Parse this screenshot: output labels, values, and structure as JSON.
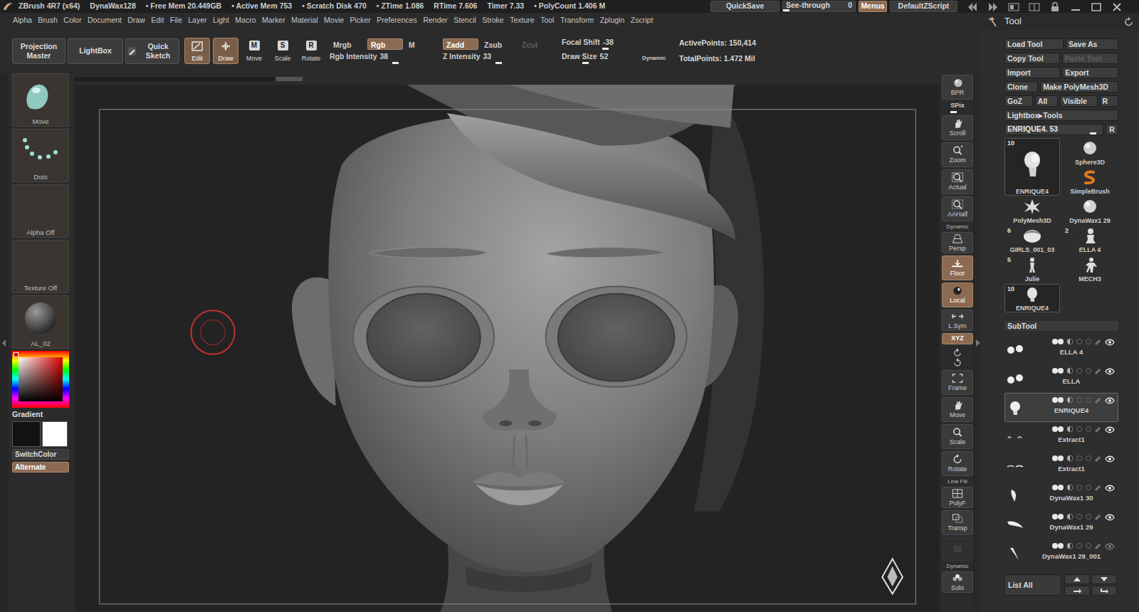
{
  "title_bar": {
    "items": [
      "ZBrush 4R7 (x64)",
      "DynaWax128",
      "• Free Mem 20.449GB",
      "• Active Mem 753",
      "• Scratch Disk 470",
      "• ZTime 1.086",
      "RTime 7.606",
      "Timer 7.33",
      "• PolyCount 1.406 M"
    ],
    "quicksave": "QuickSave",
    "see_through": {
      "label": "See-through",
      "value": "0",
      "level": 0
    },
    "menus": {
      "label": "Menus",
      "on": true
    },
    "script": "DefaultZScript"
  },
  "menu_bar": [
    "Alpha",
    "Brush",
    "Color",
    "Document",
    "Draw",
    "Edit",
    "File",
    "Layer",
    "Light",
    "Macro",
    "Marker",
    "Material",
    "Movie",
    "Picker",
    "Preferences",
    "Render",
    "Stencil",
    "Stroke",
    "Texture",
    "Tool",
    "Transform",
    "Zplugin",
    "Zscript"
  ],
  "shelf": {
    "buttons": [
      "Projection Master",
      "LightBox",
      "Quick Sketch"
    ],
    "modes": [
      {
        "label": "Edit",
        "selected": true
      },
      {
        "label": "Draw",
        "selected": true
      },
      {
        "label": "Move",
        "glyph": "M",
        "selected": false
      },
      {
        "label": "Scale",
        "glyph": "S",
        "selected": false
      },
      {
        "label": "Rotate",
        "glyph": "R",
        "selected": false
      }
    ],
    "toggles": [
      {
        "label": "Mrgb",
        "on": false,
        "disabled": false
      },
      {
        "label": "Rgb",
        "on": true,
        "disabled": false
      },
      {
        "label": "M",
        "on": false,
        "disabled": false
      },
      {
        "label": "Zadd",
        "on": true,
        "disabled": false
      },
      {
        "label": "Zsub",
        "on": false,
        "disabled": false
      },
      {
        "label": "Zcut",
        "on": false,
        "disabled": true
      }
    ],
    "intensity_sliders": [
      {
        "label": "Rgb Intensity",
        "value": "38",
        "level": 0.6
      },
      {
        "label": "Z Intensity",
        "value": "33",
        "level": 0.5
      }
    ],
    "brush_sliders": [
      {
        "label": "Focal Shift",
        "value": "-38",
        "level": 0.4
      },
      {
        "label": "Draw Size",
        "value": "52",
        "level": 0.3
      }
    ],
    "dynamic": {
      "label": "Dynamic",
      "on": false
    },
    "stats": [
      "ActivePoints: 150,414",
      "TotalPoints: 1.472 Mil"
    ]
  },
  "left_shelf": {
    "brush": "Move",
    "stroke": "Dots",
    "alpha": "Alpha Off",
    "texture": "Texture Off",
    "material": "AL_02",
    "picker": {
      "color": "#e00000"
    },
    "gradient": "Gradient",
    "swatches": [
      {
        "color": "#121212"
      },
      {
        "color": "#ffffff"
      }
    ],
    "switch_color": "SwitchColor",
    "alternate": {
      "label": "Alternate",
      "on": true
    }
  },
  "right_toolbar": [
    {
      "kind": "button",
      "label": "BPR",
      "on": false,
      "disabled": false
    },
    {
      "kind": "slider",
      "label": "SPix",
      "level": 0.35,
      "on": false,
      "disabled": false
    },
    {
      "kind": "button",
      "label": "Scroll",
      "on": false,
      "disabled": false
    },
    {
      "kind": "button",
      "label": "Zoom",
      "on": false,
      "disabled": false
    },
    {
      "kind": "button",
      "label": "Actual",
      "on": false,
      "disabled": false
    },
    {
      "kind": "button",
      "label": "AAHalf",
      "on": false,
      "disabled": false
    },
    {
      "kind": "short",
      "label": "Persp",
      "sub": "Dynamic",
      "on": false,
      "disabled": false
    },
    {
      "kind": "button",
      "label": "Floor",
      "on": true,
      "disabled": false
    },
    {
      "kind": "button",
      "label": "Local",
      "on": true,
      "disabled": false
    },
    {
      "kind": "short",
      "label": "L.Sym",
      "on": false,
      "disabled": false
    },
    {
      "kind": "tiny",
      "label": "XYZ",
      "on": true,
      "disabled": false
    },
    {
      "kind": "icons",
      "on": false,
      "disabled": false
    },
    {
      "kind": "button",
      "label": "Frame",
      "on": false,
      "disabled": false
    },
    {
      "kind": "button",
      "label": "Move",
      "on": false,
      "disabled": false
    },
    {
      "kind": "button",
      "label": "Scale",
      "on": false,
      "disabled": false
    },
    {
      "kind": "button",
      "label": "Rotate",
      "on": false,
      "disabled": false
    },
    {
      "kind": "short",
      "label": "PolyF",
      "sub": "Line Fill",
      "on": false,
      "disabled": false
    },
    {
      "kind": "button",
      "label": "Transp",
      "on": false,
      "disabled": false
    },
    {
      "kind": "blank",
      "on": false,
      "disabled": true
    },
    {
      "kind": "short",
      "label": "Solo",
      "sub": "Dynamic",
      "on": false,
      "disabled": false
    }
  ],
  "tool_panel": {
    "title": "Tool",
    "button_rows": [
      [
        {
          "label": "Load Tool",
          "disabled": false
        },
        {
          "label": "Save As",
          "disabled": false
        }
      ],
      [
        {
          "label": "Copy Tool",
          "disabled": false
        },
        {
          "label": "Paste Tool",
          "disabled": true
        }
      ],
      [
        {
          "label": "Import",
          "disabled": false
        },
        {
          "label": "Export",
          "disabled": false
        }
      ],
      [
        {
          "label": "Clone",
          "disabled": false
        },
        {
          "label": "Make PolyMesh3D",
          "disabled": false
        }
      ],
      [
        {
          "label": "GoZ",
          "disabled": false
        },
        {
          "label": "All",
          "disabled": false
        },
        {
          "label": "Visible",
          "disabled": false
        },
        {
          "label": "R",
          "disabled": false
        }
      ]
    ],
    "lightbox": "Lightbox▸Tools",
    "tool_slider": {
      "label": "ENRIQUE4. 53",
      "level": 0.93,
      "reset": "R"
    },
    "thumbnails": [
      {
        "label": "ENRIQUE4",
        "count": "10",
        "selected": true
      },
      {
        "label": "Sphere3D",
        "selected": false
      },
      {
        "label": "SimpleBrush",
        "selected": false
      },
      {
        "label": "PolyMesh3D",
        "selected": false
      },
      {
        "label": "DynaWax1 29",
        "selected": false
      },
      {
        "label": "GIRLS_001_03",
        "count": "6",
        "selected": false
      },
      {
        "label": "ELLA 4",
        "count": "2",
        "selected": false
      },
      {
        "label": "Julie",
        "count": "5",
        "selected": false
      },
      {
        "label": "MECH3",
        "selected": false
      },
      {
        "label": "ENRIQUE4",
        "count": "10",
        "selected": true
      }
    ],
    "subtool": {
      "title": "SubTool",
      "items": [
        {
          "name": "ELLA 4",
          "selected": false,
          "visible": true
        },
        {
          "name": "ELLA",
          "selected": false,
          "visible": true
        },
        {
          "name": "ENRIQUE4",
          "selected": true,
          "visible": true
        },
        {
          "name": "Extract1",
          "selected": false,
          "visible": true
        },
        {
          "name": "Extract1",
          "selected": false,
          "visible": true
        },
        {
          "name": "DynaWax1 30",
          "selected": false,
          "visible": true
        },
        {
          "name": "DynaWax1 29",
          "selected": false,
          "visible": true
        },
        {
          "name": "DynaWax1 29_001",
          "selected": false,
          "visible": false
        }
      ],
      "list_all": "List All"
    }
  }
}
